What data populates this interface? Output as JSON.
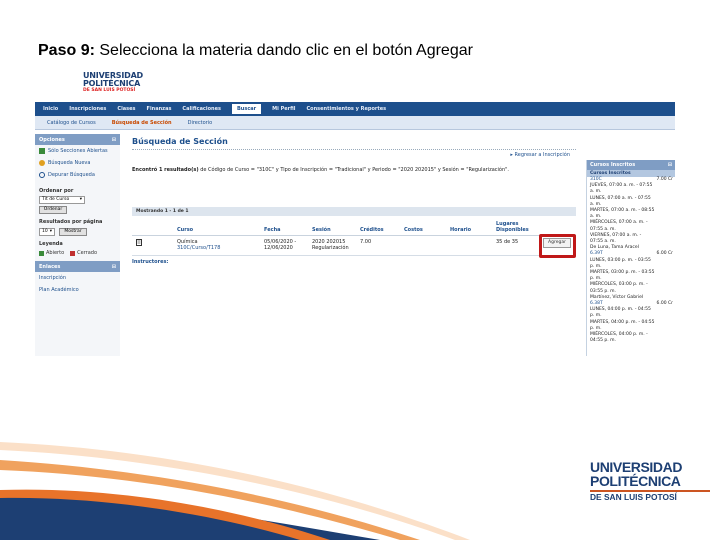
{
  "slide": {
    "title_bold": "Paso 9:",
    "title_rest": " Selecciona la materia dando  clic en el botón Agregar"
  },
  "logo": {
    "line1": "UNIVERSIDAD",
    "line2": "POLITÉCNICA",
    "line3": "DE SAN LUIS POTOSÍ"
  },
  "nav": {
    "items": [
      "Inicio",
      "Inscripciones",
      "Clases",
      "Finanzas",
      "Calificaciones",
      "Buscar",
      "Mi Perfil",
      "Consentimientos y Reportes"
    ],
    "active_index": 5
  },
  "subnav": {
    "items": [
      "Catálogo de Cursos",
      "Búsqueda de Sección",
      "Directorio"
    ],
    "active_index": 1
  },
  "sidebar": {
    "options_title": "Opciones",
    "links": [
      "Sólo Secciones Abiertas",
      "Búsqueda Nueva",
      "Depurar Búsqueda"
    ],
    "order_label": "Ordenar por",
    "order_value": "Tít de Curso",
    "order_button": "Ordenar",
    "per_page_label": "Resultados por página",
    "per_page_value": "10",
    "per_page_button": "Mostrar",
    "legend_label": "Leyenda",
    "legend_open": "Abierto",
    "legend_closed": "Cerrado",
    "links_title": "Enlaces",
    "links2": [
      "Inscripción",
      "Plan Académico"
    ]
  },
  "main": {
    "title": "Búsqueda de Sección",
    "return_link": "Regresar a Inscripción",
    "result_prefix": "Encontró 1 resultado(s)",
    "result_rest": " de Código de Curso = \"310C\" y Tipo de Inscripción = \"Tradicional\" y Periodo = \"2020 202015\" y Sesión = \"Regularización\".",
    "showing": "Mostrando 1 - 1 de 1",
    "columns": {
      "curso": "Curso",
      "fecha": "Fecha",
      "sesion": "Sesión",
      "creditos": "Créditos",
      "costos": "Costos",
      "horario": "Horario",
      "lugares": "Lugares Disponibles"
    },
    "row": {
      "curso_name": "Química",
      "curso_code": "310C/Curso/T178",
      "fecha1": "05/06/2020 -",
      "fecha2": "12/06/2020",
      "sesion1": "2020 202015",
      "sesion2": "Regularización",
      "creditos": "7.00",
      "lugares": "35 de 35",
      "agregar": "Agregar"
    },
    "instructors_label": "Instructores:"
  },
  "enrolled": {
    "title": "Cursos Inscritos",
    "subtitle": "Cursos Inscritos",
    "lines": [
      {
        "text": "310C",
        "right": "7.00 Cr",
        "link": true
      },
      {
        "text": "JUEVES, 07:00 a. m. - 07:55",
        "right": "",
        "link": false
      },
      {
        "text": "a. m.",
        "right": "",
        "link": false
      },
      {
        "text": "LUNES, 07:00 a. m. - 07:55",
        "right": "",
        "link": false
      },
      {
        "text": "a. m.",
        "right": "",
        "link": false
      },
      {
        "text": "MARTES, 07:00 a. m. - 08:55",
        "right": "",
        "link": false
      },
      {
        "text": "a. m.",
        "right": "",
        "link": false
      },
      {
        "text": "MIÉRCOLES, 07:00 a. m. -",
        "right": "",
        "link": false
      },
      {
        "text": "07:55 a. m.",
        "right": "",
        "link": false
      },
      {
        "text": "VIERNES, 07:00 a. m. -",
        "right": "",
        "link": false
      },
      {
        "text": "07:55 a. m.",
        "right": "",
        "link": false
      },
      {
        "text": "De Luna, Tama Aracel",
        "right": "",
        "link": false
      },
      {
        "text": "6.39T",
        "right": "6.00 Cr",
        "link": true
      },
      {
        "text": "LUNES, 03:00 p. m. - 03:55",
        "right": "",
        "link": false
      },
      {
        "text": "p. m.",
        "right": "",
        "link": false
      },
      {
        "text": "MARTES, 03:00 p. m. - 03:55",
        "right": "",
        "link": false
      },
      {
        "text": "p. m.",
        "right": "",
        "link": false
      },
      {
        "text": "MIÉRCOLES, 03:00 p. m. -",
        "right": "",
        "link": false
      },
      {
        "text": "03:55 p. m.",
        "right": "",
        "link": false
      },
      {
        "text": "Martínez, Víctor Gabriel",
        "right": "",
        "link": false
      },
      {
        "text": "6.38T",
        "right": "6.00 Cr",
        "link": true
      },
      {
        "text": "LUNES, 04:00 p. m. - 04:55",
        "right": "",
        "link": false
      },
      {
        "text": "p. m.",
        "right": "",
        "link": false
      },
      {
        "text": "MARTES, 04:00 p. m. - 04:55",
        "right": "",
        "link": false
      },
      {
        "text": "p. m.",
        "right": "",
        "link": false
      },
      {
        "text": "MIÉRCOLES, 04:00 p. m. -",
        "right": "",
        "link": false
      },
      {
        "text": "04:55 p. m.",
        "right": "",
        "link": false
      }
    ]
  },
  "colors": {
    "brand_navy": "#1d3f73",
    "nav_blue": "#1d4f8c",
    "highlight_red": "#c01818",
    "swoosh_orange": "#e8732a"
  }
}
